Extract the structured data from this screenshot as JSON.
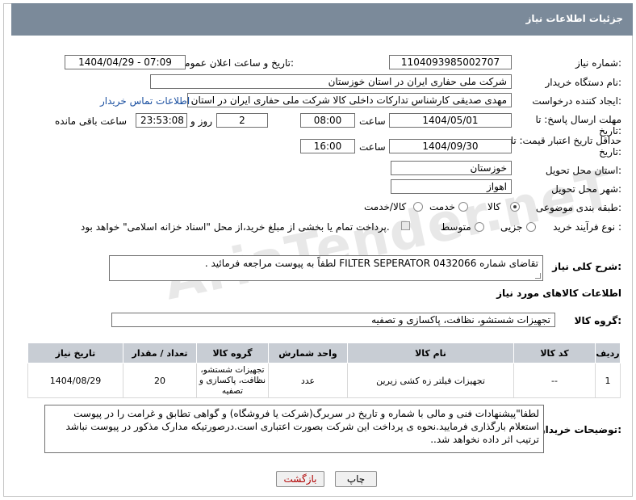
{
  "header": {
    "title": "جزئیات اطلاعات نیاز"
  },
  "labels": {
    "need_number": "شماره نیاز:",
    "announce_datetime": "تاریخ و ساعت اعلان عمومی:",
    "buyer_org": "نام دستگاه خریدار:",
    "requester": "ایجاد کننده درخواست:",
    "deadline": "مهلت ارسال پاسخ: تا تاریخ:",
    "time": "ساعت",
    "day_and": "روز و",
    "remaining": "ساعت باقی مانده",
    "min_validity": "حداقل تاریخ اعتبار قیمت: تا تاریخ:",
    "time2": "ساعت",
    "province": "استان محل تحویل:",
    "city": "شهر محل تحویل:",
    "category": "طبقه بندی موضوعی:",
    "purchase_type": "نوع فرآیند خرید :",
    "general_desc": "شرح کلی نیاز:",
    "goods_info": "اطلاعات کالاهای مورد نیاز",
    "goods_group": "گروه کالا:",
    "buyer_notes": "توضیحات خریدار:"
  },
  "values": {
    "need_number": "1104093985002707",
    "announce_datetime": "1404/04/29 - 07:09",
    "buyer_org": "شرکت ملی حفاری ایران در استان خوزستان",
    "requester": "مهدی صدیقی کارشناس تدارکات داخلی کالا شرکت ملی حفاری ایران در استان",
    "contact_link": "اطلاعات تماس خریدار",
    "deadline_date": "1404/05/01",
    "deadline_time": "08:00",
    "days": "2",
    "remaining_time": "23:53:08",
    "validity_date": "1404/09/30",
    "validity_time": "16:00",
    "province": "خوزستان",
    "city": "اهواز",
    "general_desc": "تقاضای شماره FILTER SEPERATOR 0432066 لطفاً به پیوست مراجعه فرمائید .",
    "goods_group": "تجهیزات شستشو، نظافت، پاکسازی و تصفیه",
    "buyer_notes": "لطفا\"پیشنهادات فنی و مالی با شماره و تاریخ در سربرگ(شرکت یا فروشگاه) و گواهی تطابق و غرامت را در پیوست استعلام بارگذاری فرمایید.نحوه ی پرداخت این شرکت بصورت اعتباری است.درصورتیکه مدارک مذکور در پیوست نباشد ترتیب اثر داده نخواهد شد.."
  },
  "category_options": [
    {
      "label": "کالا",
      "selected": true
    },
    {
      "label": "خدمت",
      "selected": false
    },
    {
      "label": "کالا/خدمت",
      "selected": false
    }
  ],
  "purchase_options": [
    {
      "label": "جزیی",
      "selected": false
    },
    {
      "label": "متوسط",
      "selected": false
    }
  ],
  "payment_note": "پرداخت تمام یا بخشی از مبلغ خرید،از محل \"اسناد خزانه اسلامی\" خواهد بود.",
  "watermark": "AriaTender.neT",
  "table": {
    "headers": [
      "ردیف",
      "کد کالا",
      "نام کالا",
      "واحد شمارش",
      "گروه کالا",
      "تعداد / مقدار",
      "تاریخ نیاز"
    ],
    "rows": [
      [
        "1",
        "--",
        "تجهیزات فیلتر زه کشی زیرین",
        "عدد",
        "تجهیزات شستشو، نظافت، پاکسازی و تصفیه",
        "20",
        "1404/08/29"
      ]
    ]
  },
  "buttons": {
    "print": "چاپ",
    "back": "بازگشت"
  }
}
